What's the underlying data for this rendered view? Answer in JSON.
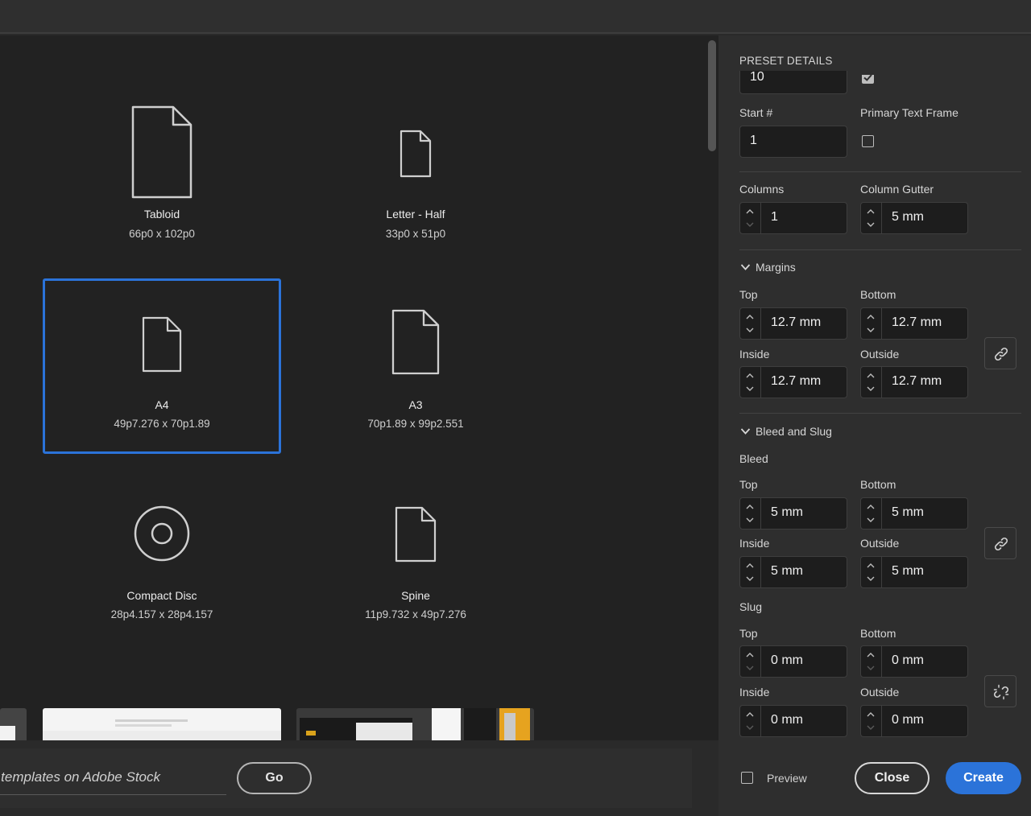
{
  "presets": [
    {
      "name": "Tabloid",
      "size": "66p0 x 102p0"
    },
    {
      "name": "Letter - Half",
      "size": "33p0 x 51p0"
    },
    {
      "name": "A4",
      "size": "49p7.276 x 70p1.89"
    },
    {
      "name": "A3",
      "size": "70p1.89 x 99p2.551"
    },
    {
      "name": "Compact Disc",
      "size": "28p4.157 x 28p4.157"
    },
    {
      "name": "Spine",
      "size": "11p9.732 x 49p7.276"
    }
  ],
  "stock": {
    "search_text": "Find more templates on Adobe Stock",
    "go_label": "Go"
  },
  "panel": {
    "header": "PRESET DETAILS",
    "pages_value": "10",
    "start_label": "Start #",
    "start_value": "1",
    "primary_text_frame_label": "Primary Text Frame",
    "columns_label": "Columns",
    "columns_value": "1",
    "column_gutter_label": "Column Gutter",
    "column_gutter_value": "5 mm",
    "margins": {
      "title": "Margins",
      "top_label": "Top",
      "top_value": "12.7 mm",
      "bottom_label": "Bottom",
      "bottom_value": "12.7 mm",
      "inside_label": "Inside",
      "inside_value": "12.7 mm",
      "outside_label": "Outside",
      "outside_value": "12.7 mm"
    },
    "bleed_slug": {
      "title": "Bleed and Slug",
      "bleed_label": "Bleed",
      "bleed_top_label": "Top",
      "bleed_top_value": "5 mm",
      "bleed_bottom_label": "Bottom",
      "bleed_bottom_value": "5 mm",
      "bleed_inside_label": "Inside",
      "bleed_inside_value": "5 mm",
      "bleed_outside_label": "Outside",
      "bleed_outside_value": "5 mm",
      "slug_label": "Slug",
      "slug_top_label": "Top",
      "slug_top_value": "0 mm",
      "slug_bottom_label": "Bottom",
      "slug_bottom_value": "0 mm",
      "slug_inside_label": "Inside",
      "slug_inside_value": "0 mm",
      "slug_outside_label": "Outside",
      "slug_outside_value": "0 mm"
    },
    "preview_label": "Preview",
    "close_label": "Close",
    "create_label": "Create"
  },
  "colors": {
    "accent": "#2b73d9",
    "panel_bg": "#2e2e2e",
    "field_bg": "#1d1d1d"
  }
}
